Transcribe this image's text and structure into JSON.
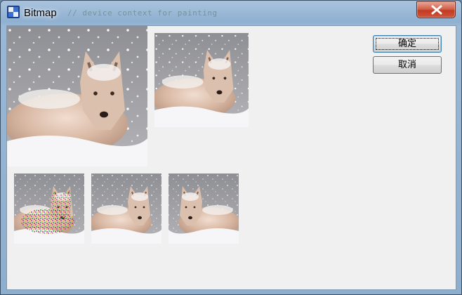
{
  "window": {
    "title": "Bitmap",
    "title_ghost_text": "// device context for painting",
    "icon": "app-icon",
    "close_icon": "close-icon"
  },
  "buttons": {
    "ok_label": "确定",
    "cancel_label": "取消"
  },
  "images": [
    {
      "name": "wolf-image-large",
      "subject": "wolf in snow"
    },
    {
      "name": "wolf-image-medium",
      "subject": "wolf in snow"
    },
    {
      "name": "wolf-image-small-color-noise",
      "subject": "wolf in snow"
    },
    {
      "name": "wolf-image-small-normal",
      "subject": "wolf in snow"
    },
    {
      "name": "wolf-image-small-mirrored",
      "subject": "wolf in snow"
    }
  ],
  "colors": {
    "client_bg": "#f0f0f0",
    "close_red": "#c13b22",
    "default_button_border": "#3c7fb1"
  }
}
